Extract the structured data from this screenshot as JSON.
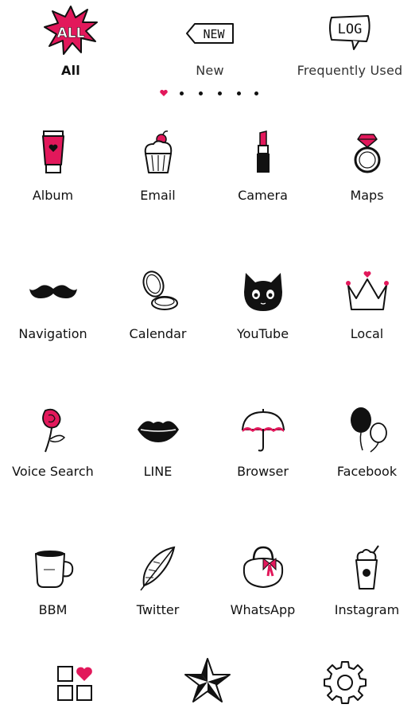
{
  "colors": {
    "accent": "#e2185b",
    "ink": "#111111",
    "background": "#ffffff"
  },
  "top_tabs": [
    {
      "label": "All",
      "icon": "all-burst-icon",
      "icon_text": "ALL",
      "active": true
    },
    {
      "label": "New",
      "icon": "new-tag-icon",
      "icon_text": "NEW",
      "active": false
    },
    {
      "label": "Frequently Used",
      "icon": "log-bubble-icon",
      "icon_text": "LOG",
      "active": false
    }
  ],
  "pager": {
    "current_page": 1,
    "total_pages": 6
  },
  "apps": [
    {
      "label": "Album",
      "icon": "lotion-tube-icon"
    },
    {
      "label": "Email",
      "icon": "cupcake-icon"
    },
    {
      "label": "Camera",
      "icon": "lipstick-icon"
    },
    {
      "label": "Maps",
      "icon": "diamond-ring-icon"
    },
    {
      "label": "Navigation",
      "icon": "mustache-icon"
    },
    {
      "label": "Calendar",
      "icon": "compact-mirror-icon"
    },
    {
      "label": "YouTube",
      "icon": "black-cat-icon"
    },
    {
      "label": "Local",
      "icon": "crown-icon"
    },
    {
      "label": "Voice Search",
      "icon": "rose-icon"
    },
    {
      "label": "LINE",
      "icon": "lips-icon"
    },
    {
      "label": "Browser",
      "icon": "umbrella-icon"
    },
    {
      "label": "Facebook",
      "icon": "balloons-icon"
    },
    {
      "label": "BBM",
      "icon": "coffee-cup-icon"
    },
    {
      "label": "Twitter",
      "icon": "feather-icon"
    },
    {
      "label": "WhatsApp",
      "icon": "handbag-icon"
    },
    {
      "label": "Instagram",
      "icon": "frappe-cup-icon"
    }
  ],
  "dock": [
    {
      "icon": "app-grid-heart-icon"
    },
    {
      "icon": "nautical-star-icon"
    },
    {
      "icon": "gear-icon"
    }
  ]
}
